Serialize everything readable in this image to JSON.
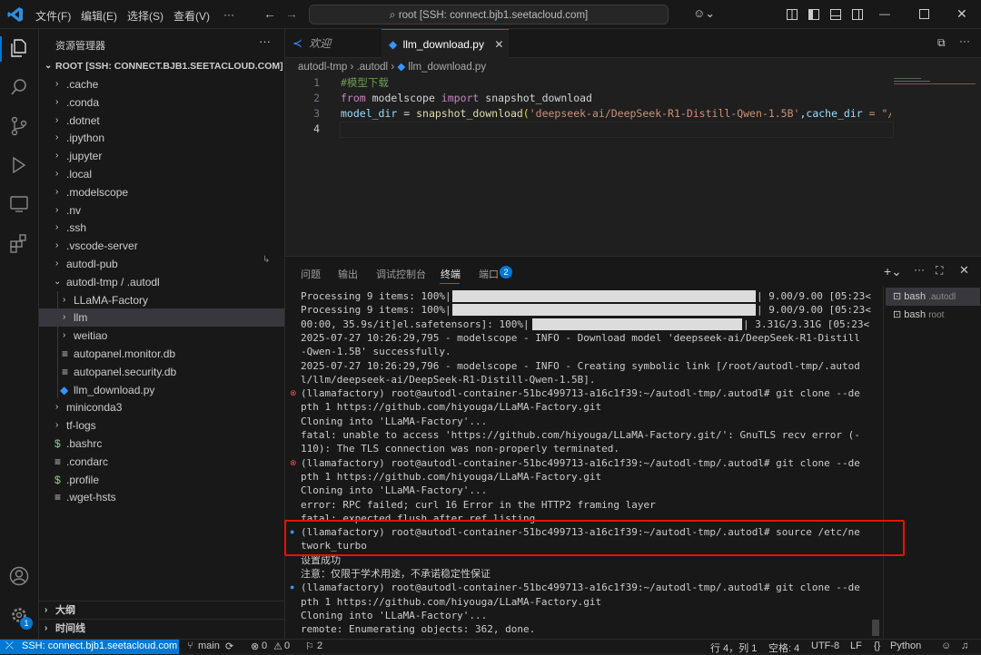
{
  "titlebar": {
    "menus": [
      "文件(F)",
      "编辑(E)",
      "选择(S)",
      "查看(V)",
      "···"
    ],
    "command_center": "root [SSH: connect.bjb1.seetacloud.com]"
  },
  "sidebar": {
    "title": "资源管理器",
    "more": "···",
    "root_label": "ROOT [SSH: CONNECT.BJB1.SEETACLOUD.COM]",
    "items": [
      ".cache",
      ".conda",
      ".dotnet",
      ".ipython",
      ".jupyter",
      ".local",
      ".modelscope",
      ".nv",
      ".ssh",
      ".vscode-server",
      "autodl-pub",
      "autodl-tmp / .autodl",
      "LLaMA-Factory",
      "llm",
      "weitiao",
      "autopanel.monitor.db",
      "autopanel.security.db",
      "llm_download.py",
      "miniconda3",
      "tf-logs",
      ".bashrc",
      ".condarc",
      ".profile",
      ".wget-hsts"
    ],
    "outline": "大纲",
    "timeline": "时间线"
  },
  "editor": {
    "tabs": [
      "欢迎",
      "llm_download.py"
    ],
    "breadcrumb": [
      "autodl-tmp",
      ".autodl",
      "llm_download.py"
    ],
    "line_numbers": [
      "1",
      "2",
      "3",
      "4"
    ],
    "code": {
      "l1": "#模型下载",
      "l2_kw1": "from",
      "l2_mod": " modelscope ",
      "l2_kw2": "import",
      "l2_fn": " snapshot_download",
      "l3_var": "model_dir",
      "l3_eq": " = ",
      "l3_fn": "snapshot_download",
      "l3_p": "(",
      "l3_str": "'deepseek-ai/DeepSeek-R1-Distill-Qwen-1.5B'",
      "l3_comma": ",",
      "l3_kw": "cache_dir",
      "l3_rest": " = \"/"
    }
  },
  "panel": {
    "tabs": [
      "问题",
      "输出",
      "调试控制台",
      "终端",
      "端口"
    ],
    "ports_badge": "2",
    "terminal_sessions": [
      {
        "name": "bash",
        "detail": ".autodl"
      },
      {
        "name": "bash",
        "detail": "root"
      }
    ],
    "terminal_lines": [
      "Processing 9 items: 100%|",
      "Processing 9 items: 100%|",
      "00:00, 35.9s/it]el.safetensors]: 100%|",
      "2025-07-27 10:26:29,795 - modelscope - INFO - Download model 'deepseek-ai/DeepSeek-R1-Distill",
      "-Qwen-1.5B' successfully.",
      "2025-07-27 10:26:29,796 - modelscope - INFO - Creating symbolic link [/root/autodl-tmp/.autod",
      "l/llm/deepseek-ai/DeepSeek-R1-Distill-Qwen-1.5B].",
      "(llamafactory) root@autodl-container-51bc499713-a16c1f39:~/autodl-tmp/.autodl# git clone --de",
      "pth 1 https://github.com/hiyouga/LLaMA-Factory.git",
      "Cloning into 'LLaMA-Factory'...",
      "fatal: unable to access 'https://github.com/hiyouga/LLaMA-Factory.git/': GnuTLS recv error (-",
      "110): The TLS connection was non-properly terminated.",
      "(llamafactory) root@autodl-container-51bc499713-a16c1f39:~/autodl-tmp/.autodl# git clone --de",
      "pth 1 https://github.com/hiyouga/LLaMA-Factory.git",
      "Cloning into 'LLaMA-Factory'...",
      "error: RPC failed; curl 16 Error in the HTTP2 framing layer",
      "fatal: expected flush after ref listing",
      "(llamafactory) root@autodl-container-51bc499713-a16c1f39:~/autodl-tmp/.autodl# source /etc/ne",
      "twork_turbo",
      "设置成功",
      "注意：仅限于学术用途，不承诺稳定性保证",
      "(llamafactory) root@autodl-container-51bc499713-a16c1f39:~/autodl-tmp/.autodl# git clone --de",
      "pth 1 https://github.com/hiyouga/LLaMA-Factory.git",
      "Cloning into 'LLaMA-Factory'...",
      "remote: Enumerating objects: 362, done."
    ],
    "progress_suffix": [
      "| 9.00/9.00 [05:23<",
      "| 9.00/9.00 [05:23<",
      "| 3.31G/3.31G [05:23<"
    ],
    "progress_fraction": [
      1.0,
      1.0,
      1.0
    ]
  },
  "statusbar": {
    "remote": "SSH: connect.bjb1.seetacloud.com",
    "branch": "main",
    "errors": "0",
    "warnings": "0",
    "ports": "2",
    "position": "行 4，列 1",
    "spaces": "空格: 4",
    "encoding": "UTF-8",
    "eol": "LF",
    "language": "Python"
  },
  "colors": {
    "accent": "#0078d4",
    "highlight_box": "#e51400",
    "error_dot": "#f14c4c",
    "info_dot": "#3794ff"
  }
}
